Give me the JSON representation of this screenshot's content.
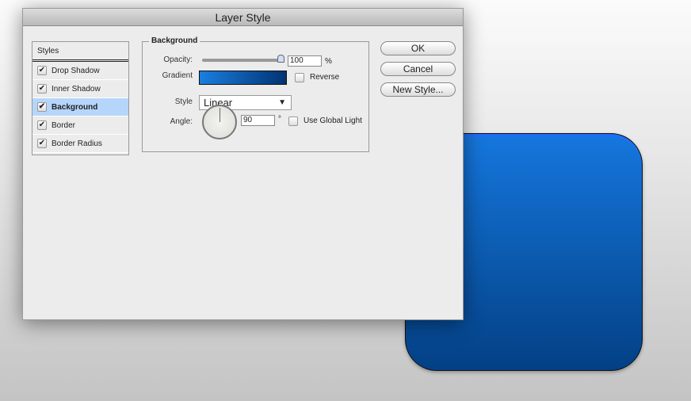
{
  "dialog": {
    "title": "Layer Style"
  },
  "styles": {
    "header": "Styles",
    "items": [
      {
        "label": "Drop Shadow",
        "checked": true,
        "selected": false
      },
      {
        "label": "Inner Shadow",
        "checked": true,
        "selected": false
      },
      {
        "label": "Background",
        "checked": true,
        "selected": true
      },
      {
        "label": "Border",
        "checked": true,
        "selected": false
      },
      {
        "label": "Border Radius",
        "checked": true,
        "selected": false
      }
    ]
  },
  "background": {
    "legend": "Background",
    "opacity_label": "Opacity:",
    "opacity_value": "100",
    "opacity_unit": "%",
    "gradient_label": "Gradient",
    "gradient_colors": [
      "#1a7ee0",
      "#023372"
    ],
    "reverse_label": "Reverse",
    "style_label": "Style",
    "style_value": "Linear",
    "angle_label": "Angle:",
    "angle_value": "90",
    "angle_unit": "°",
    "global_light_label": "Use Global Light"
  },
  "buttons": {
    "ok": "OK",
    "cancel": "Cancel",
    "new_style": "New Style..."
  },
  "check_glyph": "✔",
  "dropdown_glyph": "▼"
}
